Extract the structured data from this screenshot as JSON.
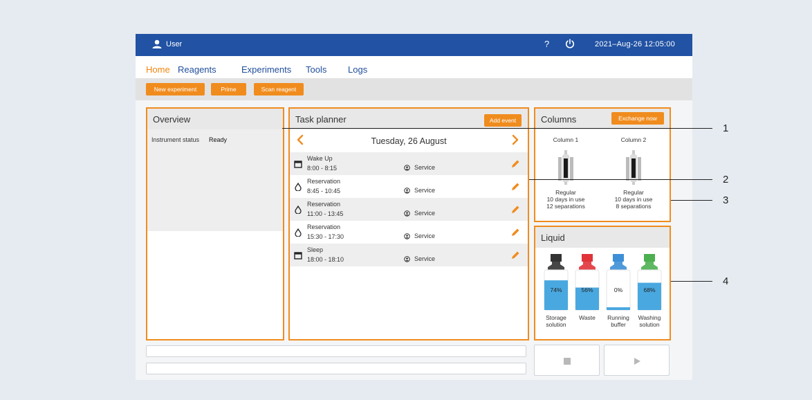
{
  "topbar": {
    "user": "User",
    "help": "?",
    "datetime": "2021–Aug-26  12:05:00"
  },
  "nav": {
    "tabs": [
      "Home",
      "Reagents",
      "Experiments",
      "Tools",
      "Logs"
    ],
    "active": "Home"
  },
  "toolbar": {
    "new_experiment": "New experiment",
    "prime": "Prime",
    "scan_reagent": "Scan reagent"
  },
  "overview": {
    "title": "Overview",
    "status_label": "Instrument status",
    "status_value": "Ready"
  },
  "planner": {
    "title": "Task planner",
    "add_event": "Add event",
    "date": "Tuesday, 26 August",
    "events": [
      {
        "name": "Wake Up",
        "time": "8:00 - 8:15",
        "service": "Service",
        "icon": "calendar-icon"
      },
      {
        "name": "Reservation",
        "time": "8:45 - 10:45",
        "service": "Service",
        "icon": "drop-icon"
      },
      {
        "name": "Reservation",
        "time": "11:00 - 13:45",
        "service": "Service",
        "icon": "drop-icon"
      },
      {
        "name": "Reservation",
        "time": "15:30 - 17:30",
        "service": "Service",
        "icon": "drop-icon"
      },
      {
        "name": "Sleep",
        "time": "18:00 - 18:10",
        "service": "Service",
        "icon": "calendar-icon"
      }
    ]
  },
  "columns": {
    "title": "Columns",
    "exchange": "Exchange now",
    "items": [
      {
        "name": "Column 1",
        "type": "Regular",
        "days": "10 days in use",
        "separations": "12 separations"
      },
      {
        "name": "Column 2",
        "type": "Regular",
        "days": "10 days in use",
        "separations": "8 separations"
      }
    ]
  },
  "liquid": {
    "title": "Liquid",
    "bottles": [
      {
        "label": "74%",
        "fill": 0.74,
        "cap_color": "#333333",
        "name_line1": "Storage",
        "name_line2": "solution"
      },
      {
        "label": "56%",
        "fill": 0.56,
        "cap_color": "#e0333a",
        "name_line1": "Waste",
        "name_line2": ""
      },
      {
        "label": "0%",
        "fill": 0.0,
        "cap_color": "#3d8fd6",
        "name_line1": "Running",
        "name_line2": "buffer"
      },
      {
        "label": "68%",
        "fill": 0.68,
        "cap_color": "#4caf50",
        "name_line1": "Washing",
        "name_line2": "solution"
      }
    ]
  },
  "callouts": [
    "1",
    "2",
    "3",
    "4"
  ],
  "colors": {
    "accent": "#f08c1e",
    "brand": "#2152a3",
    "liquid": "#4aa8e0"
  }
}
